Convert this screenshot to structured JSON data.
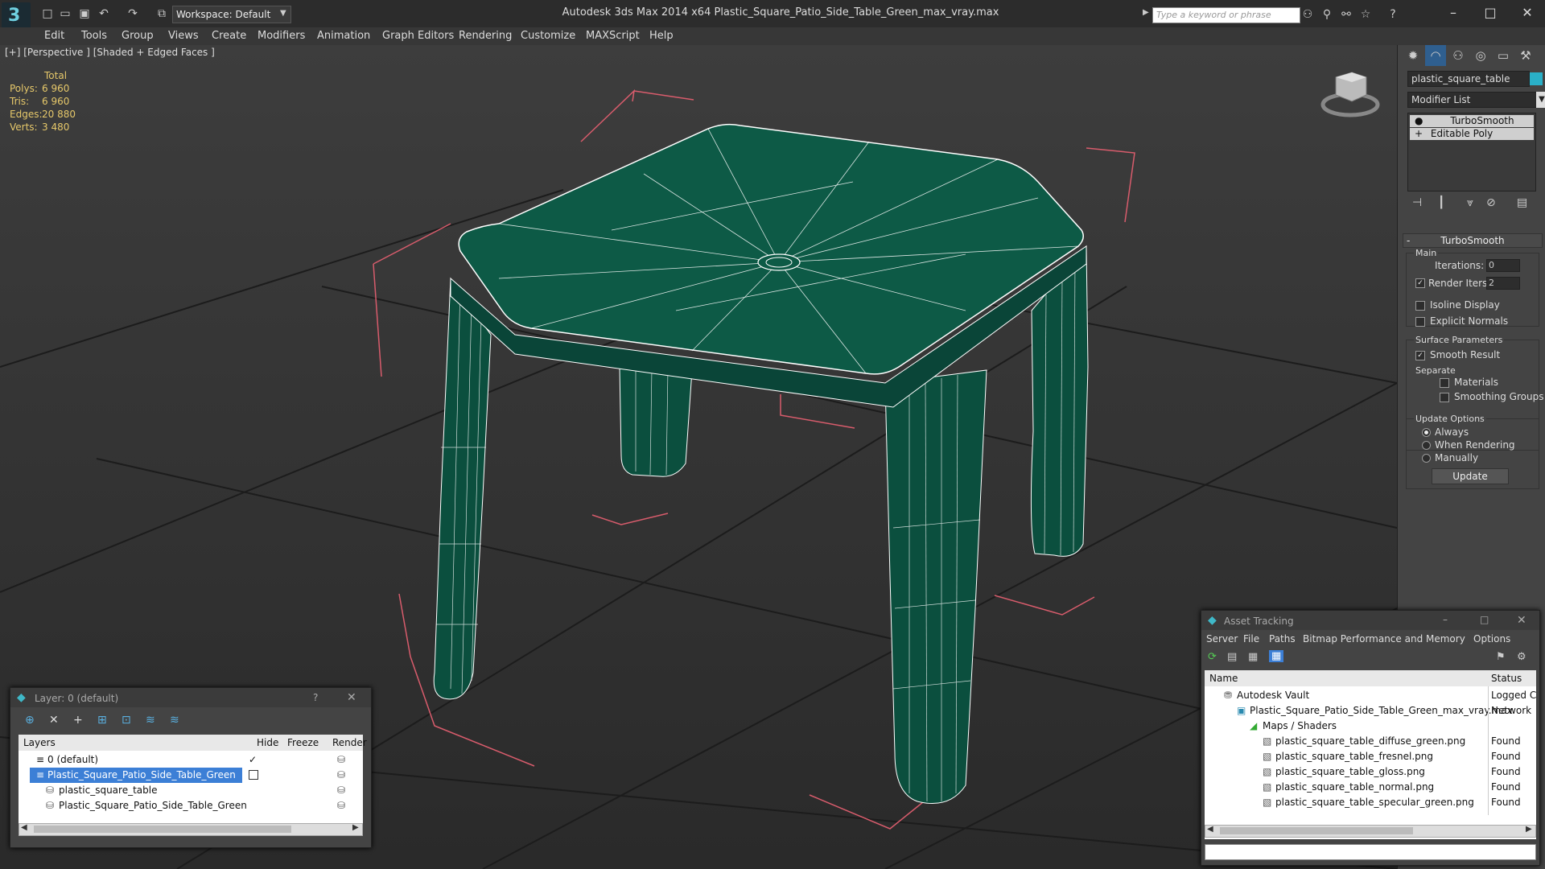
{
  "app": {
    "workspace": "Workspace: Default",
    "title": "Autodesk 3ds Max  2014 x64      Plastic_Square_Patio_Side_Table_Green_max_vray.max",
    "search_placeholder": "Type a keyword or phrase"
  },
  "menu": [
    "Edit",
    "Tools",
    "Group",
    "Views",
    "Create",
    "Modifiers",
    "Animation",
    "Graph Editors",
    "Rendering",
    "Customize",
    "MAXScript",
    "Help"
  ],
  "viewport": {
    "label": "[+] [Perspective ] [Shaded + Edged Faces ]",
    "stats_header": "Total",
    "stats": [
      {
        "label": "Polys:",
        "value": "6 960"
      },
      {
        "label": "Tris:",
        "value": "6 960"
      },
      {
        "label": "Edges:",
        "value": "20 880"
      },
      {
        "label": "Verts:",
        "value": "3 480"
      }
    ],
    "mesh_color": "#0b4f3e",
    "wire_color": "#ffffff",
    "bbox_color": "#e06070"
  },
  "command_panel": {
    "object_name": "plastic_square_table",
    "object_color": "#2ab0c8",
    "modifier_list": "Modifier List",
    "stack": [
      "TurboSmooth",
      "Editable Poly"
    ],
    "rollout_title": "TurboSmooth",
    "main_label": "Main",
    "iterations_label": "Iterations:",
    "iterations_value": "0",
    "render_iters_label": "Render Iters:",
    "render_iters_value": "2",
    "isoline_label": "Isoline Display",
    "explicit_normals_label": "Explicit Normals",
    "surface_params_label": "Surface Parameters",
    "smooth_result_label": "Smooth Result",
    "separate_label": "Separate",
    "materials_label": "Materials",
    "smoothing_groups_label": "Smoothing Groups",
    "update_options_label": "Update Options",
    "always_label": "Always",
    "when_rendering_label": "When Rendering",
    "manually_label": "Manually",
    "update_button": "Update"
  },
  "layer_dialog": {
    "title": "Layer: 0 (default)",
    "help": "?",
    "columns": [
      "Layers",
      "Hide",
      "Freeze",
      "Render"
    ],
    "rows": [
      {
        "name": "0 (default)",
        "indent": 0,
        "selected": false
      },
      {
        "name": "Plastic_Square_Patio_Side_Table_Green",
        "indent": 0,
        "selected": true
      },
      {
        "name": "plastic_square_table",
        "indent": 1,
        "selected": false
      },
      {
        "name": "Plastic_Square_Patio_Side_Table_Green",
        "indent": 1,
        "selected": false
      }
    ]
  },
  "asset_dialog": {
    "title": "Asset Tracking",
    "menu": [
      "Server",
      "File",
      "Paths",
      "Bitmap Performance and Memory",
      "Options"
    ],
    "columns": [
      "Name",
      "Status"
    ],
    "rows": [
      {
        "name": "Autodesk Vault",
        "status": "Logged C",
        "indent": 1
      },
      {
        "name": "Plastic_Square_Patio_Side_Table_Green_max_vray.max",
        "status": "Network",
        "indent": 2
      },
      {
        "name": "Maps / Shaders",
        "status": "",
        "indent": 3
      },
      {
        "name": "plastic_square_table_diffuse_green.png",
        "status": "Found",
        "indent": 4
      },
      {
        "name": "plastic_square_table_fresnel.png",
        "status": "Found",
        "indent": 4
      },
      {
        "name": "plastic_square_table_gloss.png",
        "status": "Found",
        "indent": 4
      },
      {
        "name": "plastic_square_table_normal.png",
        "status": "Found",
        "indent": 4
      },
      {
        "name": "plastic_square_table_specular_green.png",
        "status": "Found",
        "indent": 4
      }
    ]
  }
}
